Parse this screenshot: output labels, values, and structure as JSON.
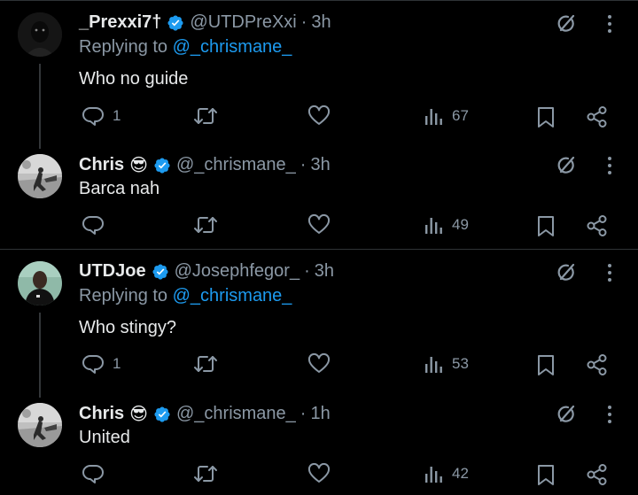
{
  "tweets": [
    {
      "name": "_Prexxi7†",
      "emoji": "",
      "handle": "@UTDPreXxi",
      "time": "3h",
      "reply_prefix": "Replying to ",
      "reply_to": "@_chrismane_",
      "text": "Who no guide",
      "replies": "1",
      "views": "67"
    },
    {
      "name": "Chris",
      "emoji": "😎",
      "handle": "@_chrismane_",
      "time": "3h",
      "text": "Barca nah",
      "replies": "",
      "views": "49"
    },
    {
      "name": "UTDJoe",
      "emoji": "",
      "handle": "@Josephfegor_",
      "time": "3h",
      "reply_prefix": "Replying to ",
      "reply_to": "@_chrismane_",
      "text": "Who stingy?",
      "replies": "1",
      "views": "53"
    },
    {
      "name": "Chris",
      "emoji": "😎",
      "handle": "@_chrismane_",
      "time": "1h",
      "text": "United",
      "replies": "",
      "views": "42"
    }
  ],
  "separator": "·",
  "colors": {
    "background": "#000000",
    "text": "#e7e9ea",
    "muted": "#8b98a5",
    "accent": "#1d9bf0",
    "divider": "#2f3336"
  },
  "icons": [
    "verified-badge-icon",
    "grok-icon",
    "more-icon",
    "reply-icon",
    "retweet-icon",
    "like-icon",
    "views-icon",
    "bookmark-icon",
    "share-icon"
  ]
}
